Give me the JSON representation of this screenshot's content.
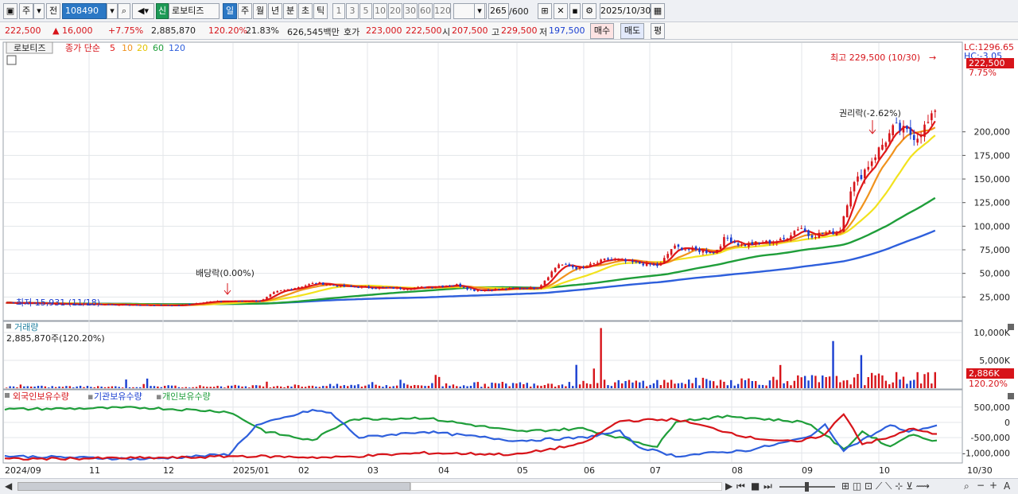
{
  "toolbar": {
    "market_btn": "주",
    "prev_btn": "전",
    "code": "108490",
    "new_badge": "신",
    "stock_name": "로보티즈",
    "period_tabs": [
      "일",
      "주",
      "월",
      "년",
      "분",
      "초",
      "틱"
    ],
    "interval_tabs": [
      "1",
      "3",
      "5",
      "10",
      "20",
      "30",
      "60",
      "120"
    ],
    "count": "265",
    "count_max": "/600",
    "date": "2025/10/30"
  },
  "info": {
    "price": "222,500",
    "change": "16,000",
    "change_pct": "+7.75%",
    "volume": "2,885,870",
    "volume_ratio": "120.20%",
    "turnover": "21.83%",
    "amount": "626,545백만",
    "quote_label": "호가",
    "ask": "223,000",
    "bid": "222,500",
    "open_label": "시",
    "open": "207,500",
    "high_label": "고",
    "high": "229,500",
    "low_label": "저",
    "low": "197,500",
    "buy_btn": "매수",
    "sell_btn": "매도",
    "avg_btn": "평"
  },
  "colors": {
    "up": "#d7141a",
    "down": "#1a3fd1",
    "ma5": "#e01818",
    "ma10": "#f0921c",
    "ma20": "#f2e21e",
    "ma60": "#1f9e3a",
    "ma120": "#2e5fdc"
  },
  "chart_data": [
    {
      "type": "candlestick",
      "legend": [
        "로보티즈",
        "종가 단순",
        "5",
        "10",
        "20",
        "60",
        "120"
      ],
      "ylim": [
        0,
        295000
      ],
      "y_ticks": [
        "200,000",
        "175,000",
        "150,000",
        "125,000",
        "100,000",
        "75,000",
        "50,000",
        "25,000"
      ],
      "x_ticks": [
        "2024/09",
        "11",
        "12",
        "2025/01",
        "02",
        "03",
        "04",
        "05",
        "06",
        "07",
        "08",
        "09",
        "10",
        "10/30"
      ],
      "right_labels": {
        "lc": "LC:1296.65",
        "hc": "HC:-3.05",
        "last_price": "222,500",
        "last_pct": "7.75%"
      },
      "annotations": {
        "max": "최고 229,500 (10/30)",
        "min": "최저 15,931 (11/18)",
        "dividend": "배당락(0.00%)",
        "rights": "권리락(-2.62%)"
      },
      "series_close": [
        {
          "x": "2024/09",
          "y": 19000
        },
        {
          "x": "2024/10",
          "y": 17500
        },
        {
          "x": "2024/11",
          "y": 16500
        },
        {
          "x": "2024/11/18",
          "y": 15931
        },
        {
          "x": "2024/12",
          "y": 20000
        },
        {
          "x": "2024/12/26",
          "y": 21000
        },
        {
          "x": "2025/01",
          "y": 30000
        },
        {
          "x": "2025/01/20",
          "y": 40000
        },
        {
          "x": "2025/02",
          "y": 36000
        },
        {
          "x": "2025/03",
          "y": 34000
        },
        {
          "x": "2025/03/25",
          "y": 38000
        },
        {
          "x": "2025/04",
          "y": 32000
        },
        {
          "x": "2025/05",
          "y": 35000
        },
        {
          "x": "2025/05/10",
          "y": 60000
        },
        {
          "x": "2025/05/20",
          "y": 55000
        },
        {
          "x": "2025/06",
          "y": 65000
        },
        {
          "x": "2025/06/25",
          "y": 58000
        },
        {
          "x": "2025/07",
          "y": 78000
        },
        {
          "x": "2025/07/20",
          "y": 72000
        },
        {
          "x": "2025/07/25",
          "y": 88000
        },
        {
          "x": "2025/08",
          "y": 80000
        },
        {
          "x": "2025/08/20",
          "y": 85000
        },
        {
          "x": "2025/08/28",
          "y": 100000
        },
        {
          "x": "2025/09",
          "y": 90000
        },
        {
          "x": "2025/09/15",
          "y": 95000
        },
        {
          "x": "2025/09/20",
          "y": 140000
        },
        {
          "x": "2025/09/25",
          "y": 155000
        },
        {
          "x": "2025/10",
          "y": 175000
        },
        {
          "x": "2025/10/10",
          "y": 205000
        },
        {
          "x": "2025/10/20",
          "y": 195000
        },
        {
          "x": "2025/10/30",
          "y": 222500
        }
      ],
      "ma60_end": 125000,
      "ma120_end": 94000
    },
    {
      "type": "bar",
      "title": "거래량",
      "value_label": "2,885,870주(120.20%)",
      "y_ticks": [
        "10,000K",
        "5,000K"
      ],
      "right_labels": {
        "last": "2,886K",
        "pct": "120.20%"
      }
    },
    {
      "type": "line",
      "series": [
        "외국인보유수량",
        "기관보유수량",
        "개인보유수량"
      ],
      "y_ticks": [
        "500,000",
        "0",
        "-500,000",
        "-1,000,000"
      ]
    }
  ]
}
